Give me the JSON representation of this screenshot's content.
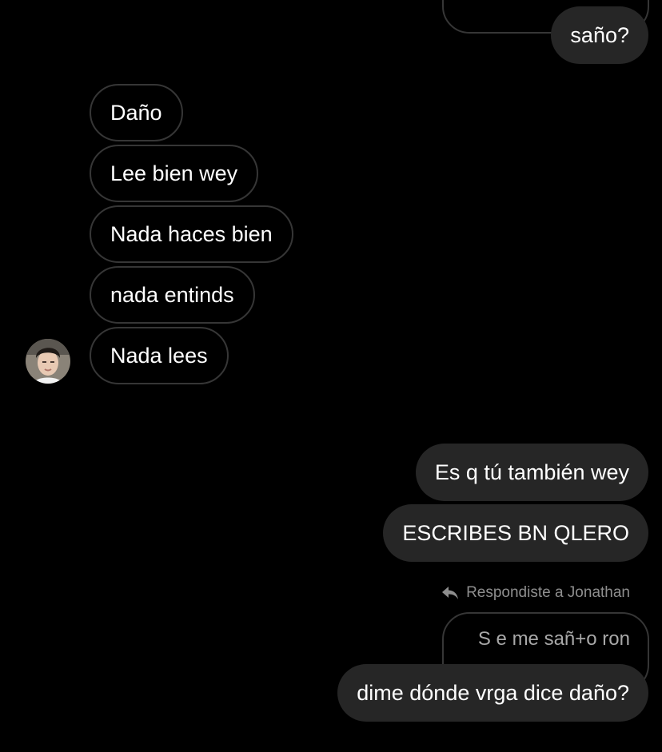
{
  "thread": {
    "top_quote_text": "",
    "top_outgoing": "saño?",
    "incoming_messages": [
      "Daño",
      "Lee bien wey",
      "Nada haces bien",
      "nada entinds",
      "Nada lees"
    ],
    "outgoing_messages": [
      "Es q tú también wey",
      "ESCRIBES BN QLERO"
    ],
    "reply_label": "Respondiste a Jonathan",
    "quoted_message": "S e me sañ+o ron",
    "final_outgoing": "dime dónde vrga dice daño?"
  },
  "icons": {
    "reply": "reply-arrow-icon",
    "avatar": "contact-avatar"
  },
  "colors": {
    "background": "#000000",
    "outgoing_bubble": "#262626",
    "incoming_border": "#363636",
    "muted_text": "#8e8e8e"
  }
}
